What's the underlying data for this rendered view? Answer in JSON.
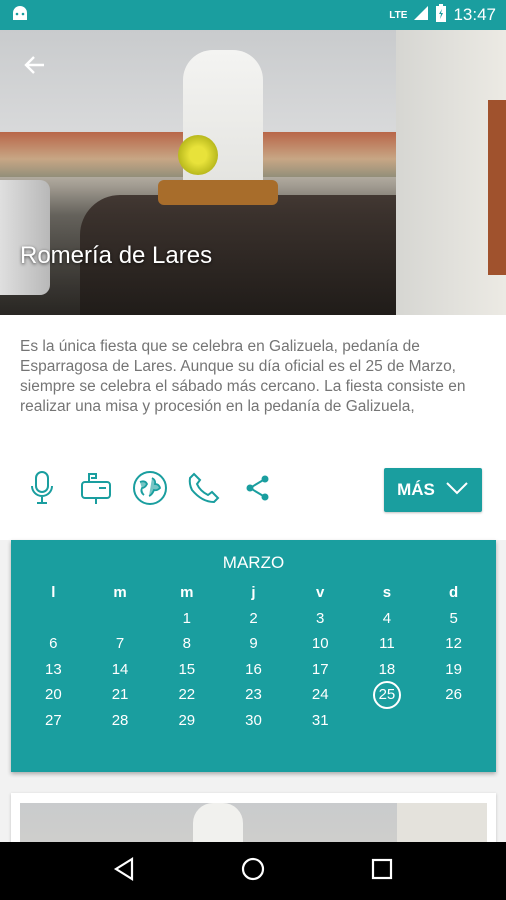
{
  "status_bar": {
    "time": "13:47",
    "network": "LTE"
  },
  "hero": {
    "title": "Romería de Lares"
  },
  "description": "Es la única fiesta que se celebra en Galizuela, pedanía de Esparragosa de Lares. Aunque su día oficial es el 25 de Marzo, siempre se celebra el sábado más cercano. La fiesta consiste en realizar una misa y procesión en la pedanía de Galizuela, posteriormente la gente se van a comer al camp…",
  "actions": {
    "icons": [
      "microphone-icon",
      "mailbox-icon",
      "globe-icon",
      "phone-icon",
      "share-icon"
    ],
    "more_label": "MÁS"
  },
  "calendar": {
    "month": "MARZO",
    "weekdays": [
      "l",
      "m",
      "m",
      "j",
      "v",
      "s",
      "d"
    ],
    "leading_blanks": 2,
    "days": [
      "1",
      "2",
      "3",
      "4",
      "5",
      "6",
      "7",
      "8",
      "9",
      "10",
      "11",
      "12",
      "13",
      "14",
      "15",
      "16",
      "17",
      "18",
      "19",
      "20",
      "21",
      "22",
      "23",
      "24",
      "25",
      "26",
      "27",
      "28",
      "29",
      "30",
      "31"
    ],
    "selected_day": "25"
  },
  "colors": {
    "accent": "#1a9e9f",
    "text_gray": "#757575"
  }
}
